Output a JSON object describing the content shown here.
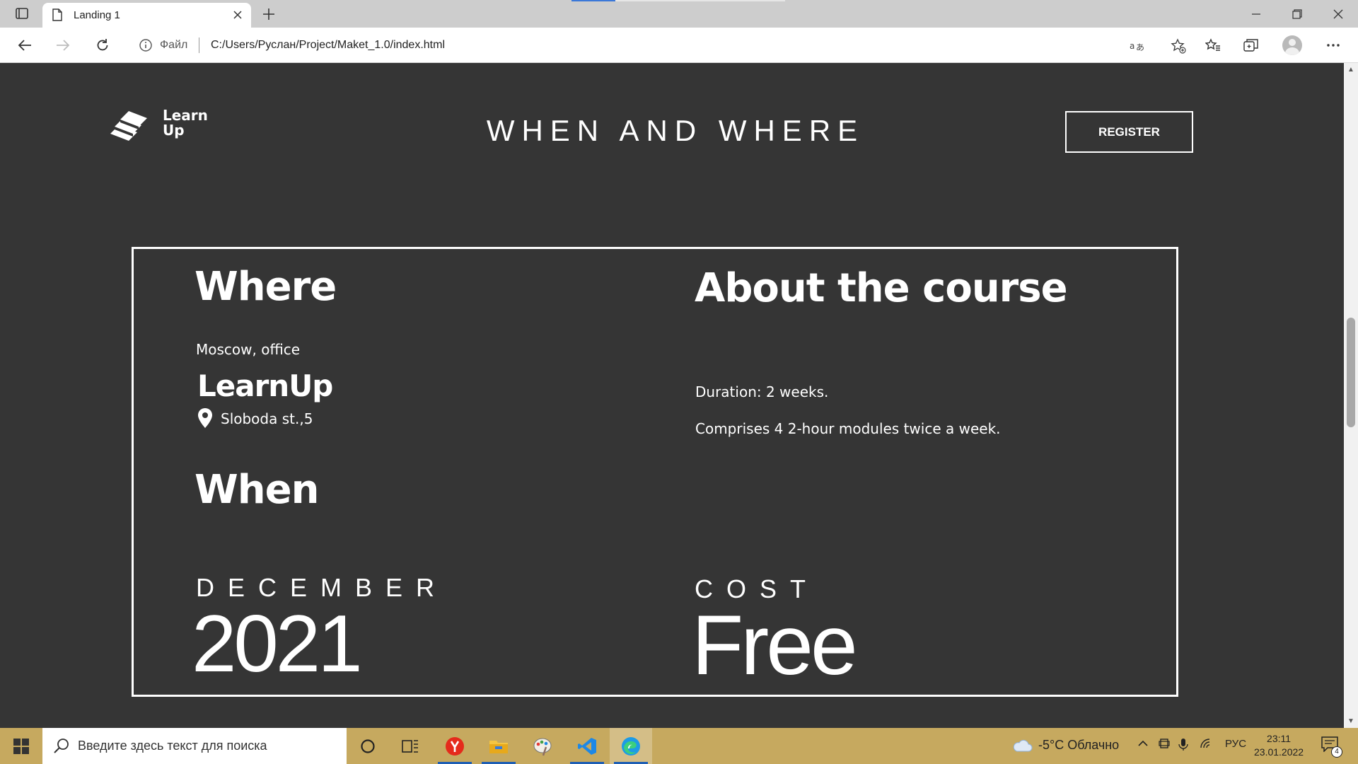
{
  "browser": {
    "tab_title": "Landing 1",
    "url_scheme": "Файл",
    "url_path": "C:/Users/Руслан/Project/Maket_1.0/index.html"
  },
  "page": {
    "logo_text_line1": "Learn",
    "logo_text_line2": "Up",
    "heading": "WHEN AND WHERE",
    "register_label": "REGISTER",
    "where": {
      "title": "Where",
      "place": "Moscow, office",
      "brand": "LearnUp",
      "address": "Sloboda st.,5"
    },
    "when": {
      "title": "When",
      "month": "DECEMBER",
      "year": "2021"
    },
    "about": {
      "title": "About the course",
      "duration": "Duration: 2 weeks.",
      "modules": "Comprises 4 2-hour modules twice a week."
    },
    "cost": {
      "label": "COST",
      "value": "Free"
    }
  },
  "taskbar": {
    "search_placeholder": "Введите здесь текст для поиска",
    "weather": "-5°C  Облачно",
    "language": "РУС",
    "time": "23:11",
    "date": "23.01.2022",
    "notification_count": "4"
  },
  "colors": {
    "page_background": "#353535",
    "taskbar": "#c6a95f",
    "accent_blue": "#1f5fb4"
  }
}
